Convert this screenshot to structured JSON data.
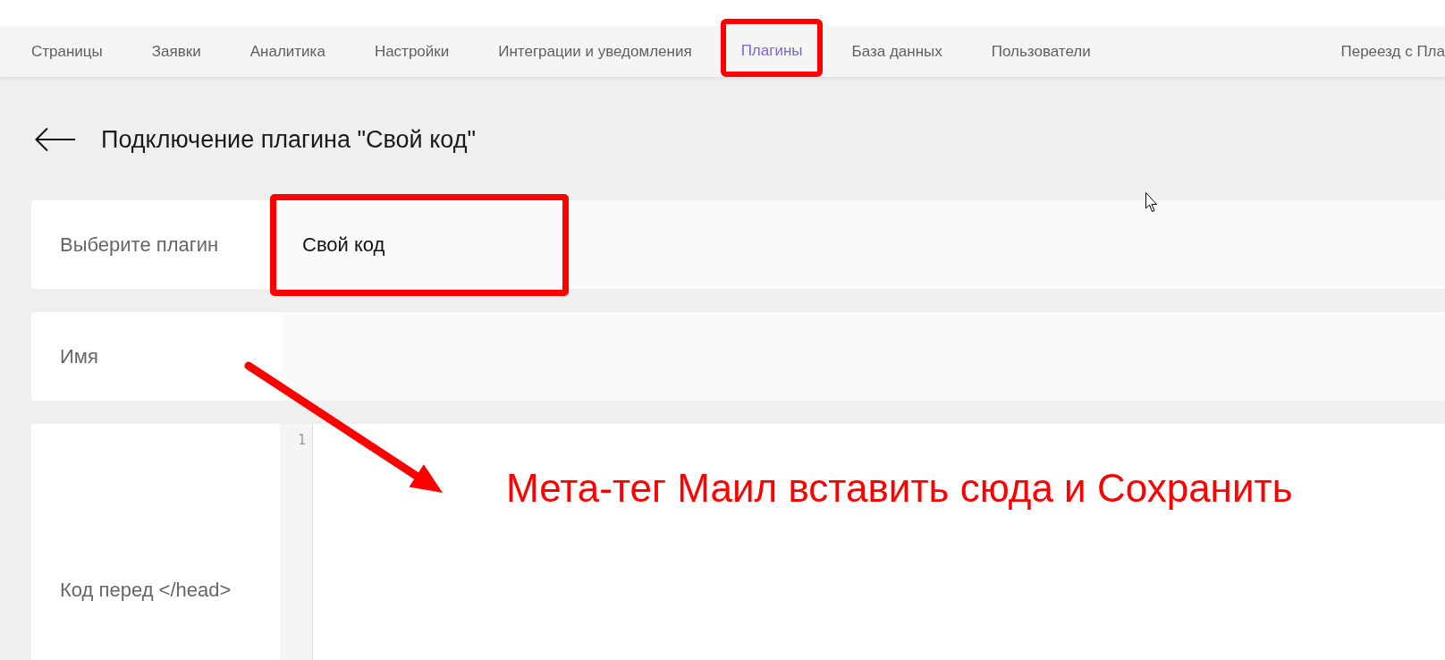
{
  "nav": {
    "items": [
      {
        "label": "Страницы",
        "selected": false,
        "highlighted": false
      },
      {
        "label": "Заявки",
        "selected": false,
        "highlighted": false
      },
      {
        "label": "Аналитика",
        "selected": false,
        "highlighted": false
      },
      {
        "label": "Настройки",
        "selected": false,
        "highlighted": false
      },
      {
        "label": "Интеграции и уведомления",
        "selected": false,
        "highlighted": false
      },
      {
        "label": "Плагины",
        "selected": true,
        "highlighted": true
      },
      {
        "label": "База данных",
        "selected": false,
        "highlighted": false
      },
      {
        "label": "Пользователи",
        "selected": false,
        "highlighted": false
      }
    ],
    "end_item": {
      "label": "Переезд с Пла",
      "selected": false
    }
  },
  "header": {
    "title": "Подключение плагина \"Свой код\""
  },
  "form": {
    "rows": [
      {
        "kind": "select",
        "label": "Выберите плагин",
        "value": "Свой код",
        "highlighted": true
      },
      {
        "kind": "text",
        "label": "Имя",
        "highlighted": false
      },
      {
        "kind": "code",
        "label": "Код перед </head>",
        "line_numbers": [
          "1"
        ],
        "highlighted": false
      }
    ]
  },
  "annotation": {
    "text": "Мета-тег Маил вставить сюда и Сохранить"
  }
}
